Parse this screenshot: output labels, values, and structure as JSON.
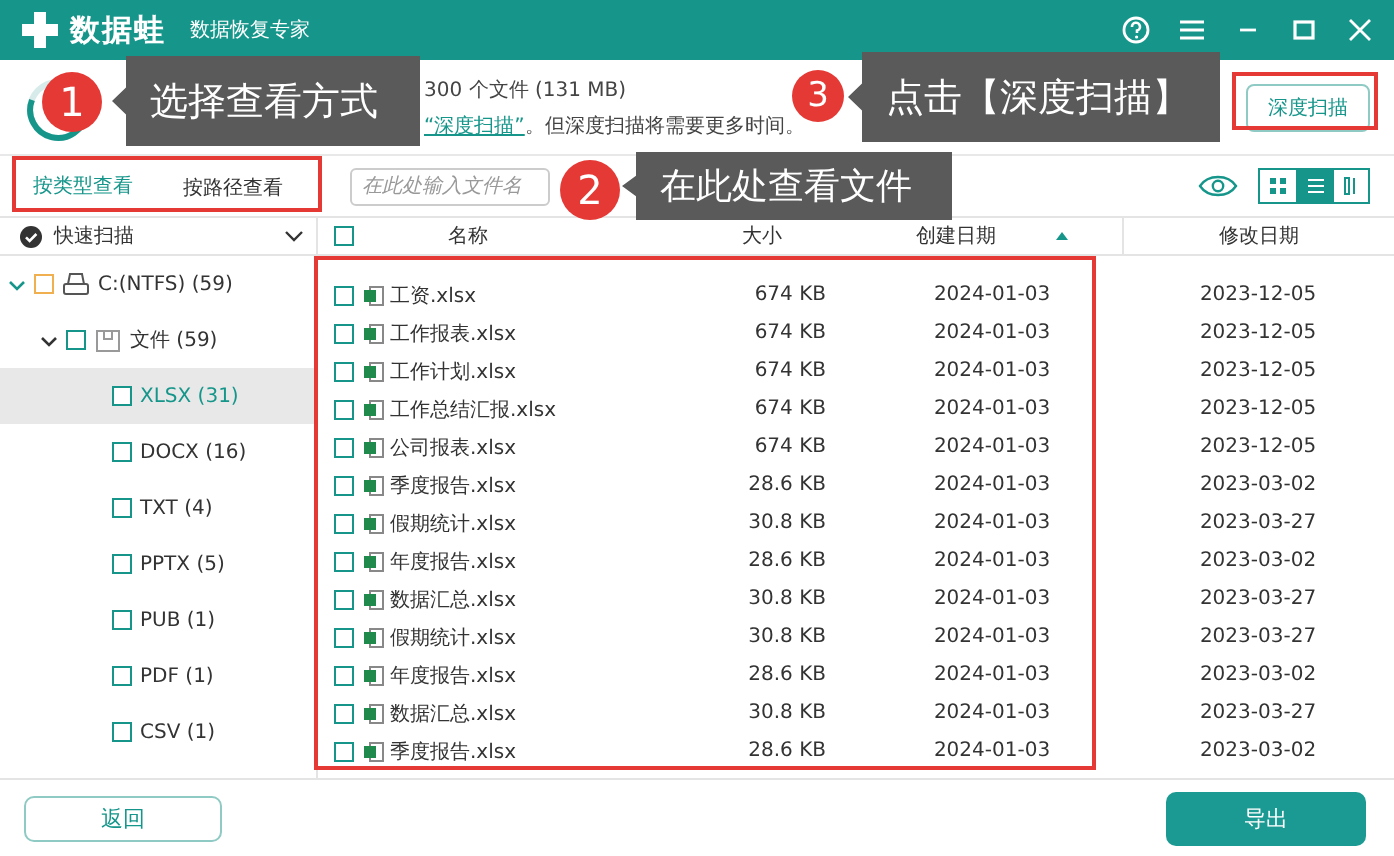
{
  "title_bar": {
    "app_name": "数据蛙",
    "subtitle": "数据恢复专家"
  },
  "scan_info": {
    "summary": "300 个文件 (131 MB)",
    "hint_link": "“深度扫描”",
    "hint_rest": "。但深度扫描将需要更多时间。"
  },
  "deep_scan_button": "深度扫描",
  "view_tabs": [
    {
      "label": "按类型查看",
      "selected": true
    },
    {
      "label": "按路径查看",
      "selected": false
    }
  ],
  "search": {
    "placeholder": "在此处输入文件名"
  },
  "view_modes": [
    {
      "kind": "grid",
      "selected": false
    },
    {
      "kind": "list",
      "selected": true
    },
    {
      "kind": "detail",
      "selected": false
    }
  ],
  "scan_header": {
    "label": "快速扫描"
  },
  "tree": [
    {
      "label": "C:(NTFS) (59)",
      "kind": "drive",
      "checked": false,
      "expanded": true,
      "selected": false,
      "children": [
        {
          "label": "文件 (59)",
          "kind": "folder",
          "checked": false,
          "expanded": true,
          "selected": false,
          "children": [
            {
              "label": "XLSX (31)",
              "kind": "type",
              "checked": false,
              "selected": true
            },
            {
              "label": "DOCX (16)",
              "kind": "type",
              "checked": false,
              "selected": false
            },
            {
              "label": "TXT (4)",
              "kind": "type",
              "checked": false,
              "selected": false
            },
            {
              "label": "PPTX (5)",
              "kind": "type",
              "checked": false,
              "selected": false
            },
            {
              "label": "PUB (1)",
              "kind": "type",
              "checked": false,
              "selected": false
            },
            {
              "label": "PDF (1)",
              "kind": "type",
              "checked": false,
              "selected": false
            },
            {
              "label": "CSV (1)",
              "kind": "type",
              "checked": false,
              "selected": false
            }
          ]
        }
      ]
    }
  ],
  "table": {
    "select_all": {
      "checked": false
    },
    "columns": [
      {
        "label": "名称",
        "sorted": false
      },
      {
        "label": "大小",
        "sorted": false
      },
      {
        "label": "创建日期",
        "sorted": true
      },
      {
        "label": "修改日期",
        "sorted": false
      }
    ],
    "rows": [
      {
        "name": "工资.xlsx",
        "size": "674 KB",
        "created": "2024-01-03",
        "modified": "2023-12-05",
        "checked": false
      },
      {
        "name": "工作报表.xlsx",
        "size": "674 KB",
        "created": "2024-01-03",
        "modified": "2023-12-05",
        "checked": false
      },
      {
        "name": "工作计划.xlsx",
        "size": "674 KB",
        "created": "2024-01-03",
        "modified": "2023-12-05",
        "checked": false
      },
      {
        "name": "工作总结汇报.xlsx",
        "size": "674 KB",
        "created": "2024-01-03",
        "modified": "2023-12-05",
        "checked": false
      },
      {
        "name": "公司报表.xlsx",
        "size": "674 KB",
        "created": "2024-01-03",
        "modified": "2023-12-05",
        "checked": false
      },
      {
        "name": "季度报告.xlsx",
        "size": "28.6 KB",
        "created": "2024-01-03",
        "modified": "2023-03-02",
        "checked": false
      },
      {
        "name": "假期统计.xlsx",
        "size": "30.8 KB",
        "created": "2024-01-03",
        "modified": "2023-03-27",
        "checked": false
      },
      {
        "name": "年度报告.xlsx",
        "size": "28.6 KB",
        "created": "2024-01-03",
        "modified": "2023-03-02",
        "checked": false
      },
      {
        "name": "数据汇总.xlsx",
        "size": "30.8 KB",
        "created": "2024-01-03",
        "modified": "2023-03-27",
        "checked": false
      },
      {
        "name": "假期统计.xlsx",
        "size": "30.8 KB",
        "created": "2024-01-03",
        "modified": "2023-03-27",
        "checked": false
      },
      {
        "name": "年度报告.xlsx",
        "size": "28.6 KB",
        "created": "2024-01-03",
        "modified": "2023-03-02",
        "checked": false
      },
      {
        "name": "数据汇总.xlsx",
        "size": "30.8 KB",
        "created": "2024-01-03",
        "modified": "2023-03-27",
        "checked": false
      },
      {
        "name": "季度报告.xlsx",
        "size": "28.6 KB",
        "created": "2024-01-03",
        "modified": "2023-03-02",
        "checked": false
      }
    ]
  },
  "footer": {
    "back_button": "返回",
    "export_button": "导出"
  },
  "annotations": [
    {
      "number": "1",
      "text": "选择查看方式"
    },
    {
      "number": "2",
      "text": "在此处查看文件"
    },
    {
      "number": "3",
      "text": "点击【深度扫描】"
    }
  ]
}
